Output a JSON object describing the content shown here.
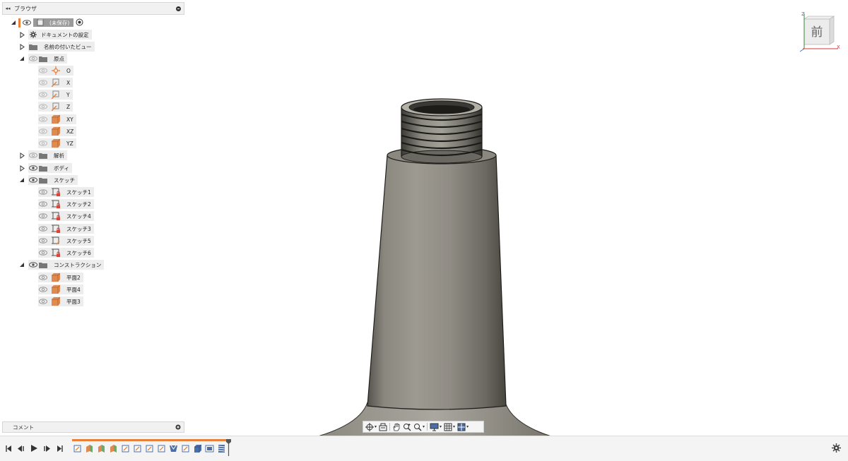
{
  "browser": {
    "title": "ブラウザ",
    "root": {
      "label": "(未保存)"
    },
    "items": [
      {
        "label": "ドキュメントの設定"
      },
      {
        "label": "名前の付いたビュー"
      },
      {
        "label": "原点"
      },
      {
        "label": "O"
      },
      {
        "label": "X"
      },
      {
        "label": "Y"
      },
      {
        "label": "Z"
      },
      {
        "label": "XY"
      },
      {
        "label": "XZ"
      },
      {
        "label": "YZ"
      },
      {
        "label": "解析"
      },
      {
        "label": "ボディ"
      },
      {
        "label": "スケッチ"
      },
      {
        "label": "スケッチ1"
      },
      {
        "label": "スケッチ2"
      },
      {
        "label": "スケッチ4"
      },
      {
        "label": "スケッチ3"
      },
      {
        "label": "スケッチ5"
      },
      {
        "label": "スケッチ6"
      },
      {
        "label": "コンストラクション"
      },
      {
        "label": "平面2"
      },
      {
        "label": "平面4"
      },
      {
        "label": "平面3"
      }
    ]
  },
  "comment": {
    "label": "コメント"
  },
  "viewcube": {
    "face": "前",
    "axis_z": "Z",
    "axis_x": "X"
  },
  "colors": {
    "accent": "#e87f3a",
    "model": "#7a776f",
    "panel": "#f1f1f1"
  }
}
